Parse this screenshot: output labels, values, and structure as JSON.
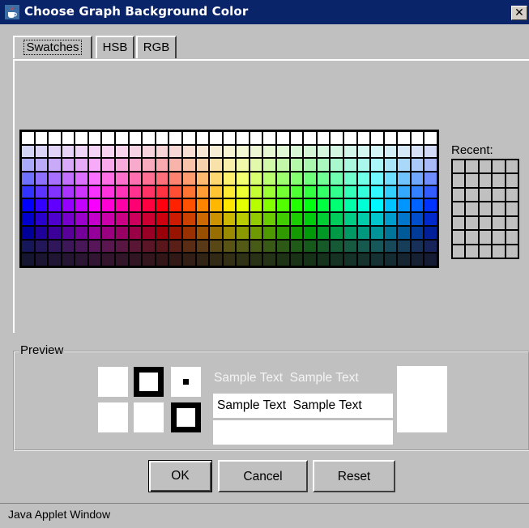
{
  "window": {
    "title": "Choose Graph Background Color",
    "close_glyph": "✕"
  },
  "tabs": [
    {
      "label": "Swatches",
      "active": true
    },
    {
      "label": "HSB",
      "active": false
    },
    {
      "label": "RGB",
      "active": false
    }
  ],
  "swatches": {
    "columns": 31,
    "rows": 10
  },
  "recent": {
    "label": "Recent:",
    "columns": 5,
    "rows": 7,
    "color": "#c0c0c0"
  },
  "preview": {
    "legend": "Preview",
    "sample_text": "Sample Text",
    "row1": "Sample Text  Sample Text",
    "row2": "Sample Text  Sample Text"
  },
  "buttons": {
    "ok": "OK",
    "cancel": "Cancel",
    "reset": "Reset"
  },
  "status": {
    "text": "Java Applet Window"
  },
  "colors": {
    "title_bar": "#0a246a",
    "window_bg": "#c0c0c0"
  },
  "icons": {
    "app": "java-cup-icon",
    "close": "close-icon"
  }
}
